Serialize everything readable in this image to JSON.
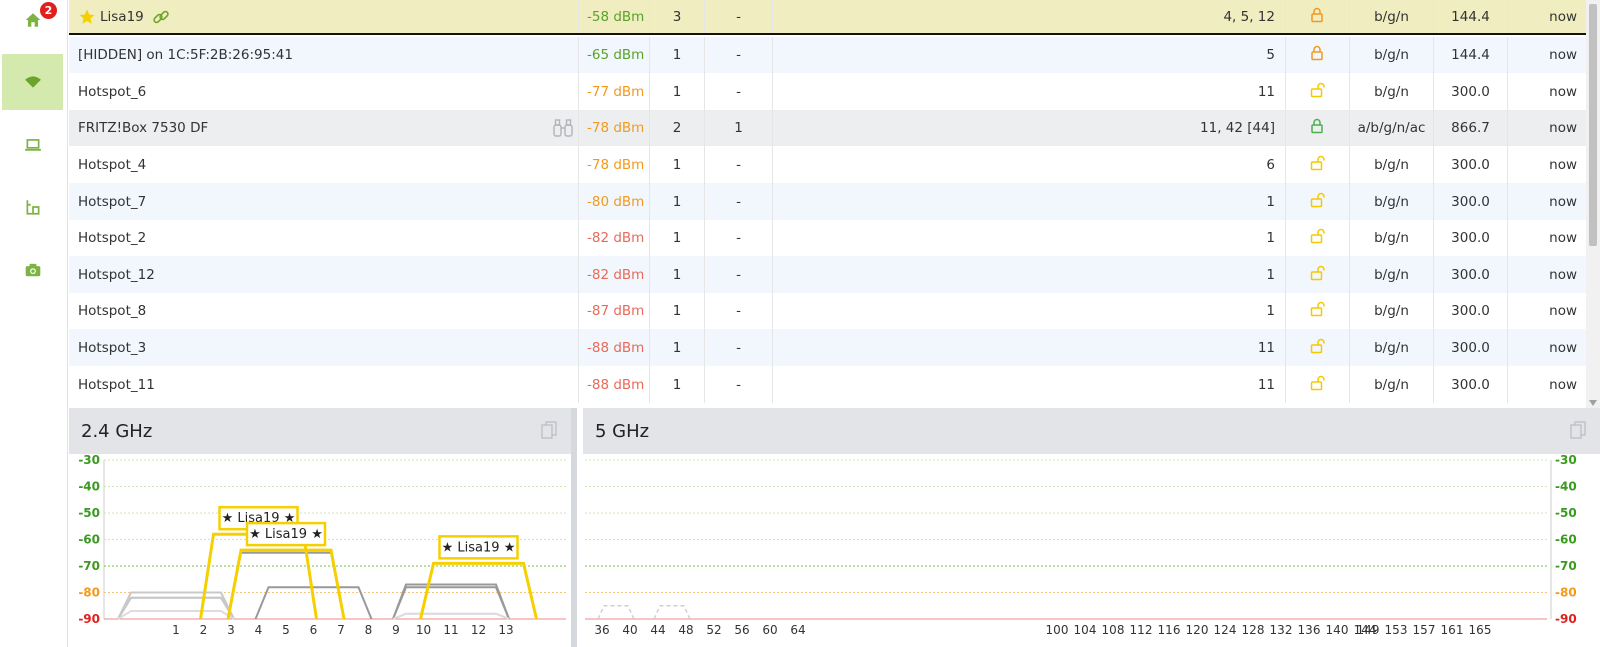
{
  "sidebar": {
    "badge": "2",
    "items": [
      {
        "icon": "home-icon"
      },
      {
        "icon": "wifi-icon",
        "active": true
      },
      {
        "icon": "laptop-icon"
      },
      {
        "icon": "floorplan-icon"
      },
      {
        "icon": "camera-icon"
      }
    ]
  },
  "networks": [
    {
      "ssid": "Lisa19",
      "signal": "-58 dBm",
      "signal_level": "green",
      "count": "3",
      "col4": "-",
      "channel": "4, 5, 12",
      "lock": "locked-orange",
      "mode": "b/g/n",
      "speed": "144.4",
      "seen": "now",
      "favorite": true,
      "connected": true
    },
    {
      "ssid": "[HIDDEN] on 1C:5F:2B:26:95:41",
      "signal": "-65 dBm",
      "signal_level": "green",
      "count": "1",
      "col4": "-",
      "channel": "5",
      "lock": "locked-orange",
      "mode": "b/g/n",
      "speed": "144.4",
      "seen": "now"
    },
    {
      "ssid": "Hotspot_6",
      "signal": "-77 dBm",
      "signal_level": "orange",
      "count": "1",
      "col4": "-",
      "channel": "11",
      "lock": "open-yellow",
      "mode": "b/g/n",
      "speed": "300.0",
      "seen": "now"
    },
    {
      "ssid": "FRITZ!Box 7530 DF",
      "signal": "-78 dBm",
      "signal_level": "orange",
      "count": "2",
      "col4": "1",
      "channel": "11, 42 [44]",
      "lock": "locked-green",
      "mode": "a/b/g/n/ac",
      "speed": "866.7",
      "seen": "now",
      "fritz": true
    },
    {
      "ssid": "Hotspot_4",
      "signal": "-78 dBm",
      "signal_level": "orange",
      "count": "1",
      "col4": "-",
      "channel": "6",
      "lock": "open-yellow",
      "mode": "b/g/n",
      "speed": "300.0",
      "seen": "now"
    },
    {
      "ssid": "Hotspot_7",
      "signal": "-80 dBm",
      "signal_level": "orange",
      "count": "1",
      "col4": "-",
      "channel": "1",
      "lock": "open-yellow",
      "mode": "b/g/n",
      "speed": "300.0",
      "seen": "now"
    },
    {
      "ssid": "Hotspot_2",
      "signal": "-82 dBm",
      "signal_level": "red",
      "count": "1",
      "col4": "-",
      "channel": "1",
      "lock": "open-yellow",
      "mode": "b/g/n",
      "speed": "300.0",
      "seen": "now"
    },
    {
      "ssid": "Hotspot_12",
      "signal": "-82 dBm",
      "signal_level": "red",
      "count": "1",
      "col4": "-",
      "channel": "1",
      "lock": "open-yellow",
      "mode": "b/g/n",
      "speed": "300.0",
      "seen": "now"
    },
    {
      "ssid": "Hotspot_8",
      "signal": "-87 dBm",
      "signal_level": "red",
      "count": "1",
      "col4": "-",
      "channel": "1",
      "lock": "open-yellow",
      "mode": "b/g/n",
      "speed": "300.0",
      "seen": "now"
    },
    {
      "ssid": "Hotspot_3",
      "signal": "-88 dBm",
      "signal_level": "red",
      "count": "1",
      "col4": "-",
      "channel": "11",
      "lock": "open-yellow",
      "mode": "b/g/n",
      "speed": "300.0",
      "seen": "now"
    },
    {
      "ssid": "Hotspot_11",
      "signal": "-88 dBm",
      "signal_level": "red",
      "count": "1",
      "col4": "-",
      "channel": "11",
      "lock": "open-yellow",
      "mode": "b/g/n",
      "speed": "300.0",
      "seen": "now"
    }
  ],
  "colors": {
    "green": "#5aa227",
    "orange": "#f39a1d",
    "red": "#e86a5a",
    "favorite": "#f5d000",
    "lock_orange": "#f39a1d",
    "lock_yellow": "#f5c800",
    "lock_green": "#4caf50",
    "accent": "#8bc34a"
  },
  "panels": {
    "band24_title": "2.4 GHz",
    "band5_title": "5 GHz"
  },
  "chart_data": [
    {
      "type": "area",
      "band": "2.4 GHz",
      "ylim": [
        -90,
        -30
      ],
      "yticks": [
        -30,
        -40,
        -50,
        -60,
        -70,
        -80,
        -90
      ],
      "xticks": [
        "1",
        "2",
        "3",
        "4",
        "5",
        "6",
        "7",
        "8",
        "9",
        "10",
        "11",
        "12",
        "13"
      ],
      "networks": [
        {
          "label": "★ Lisa19 ★",
          "center": 4,
          "signal": -58,
          "highlight": true
        },
        {
          "label": "★ Lisa19 ★",
          "center": 5,
          "signal": -64,
          "highlight": true
        },
        {
          "label": "★ Lisa19 ★",
          "center": 12,
          "signal": -69,
          "highlight": true
        },
        {
          "label": "",
          "center": 5,
          "signal": -65,
          "highlight": false
        },
        {
          "label": "",
          "center": 11,
          "signal": -77,
          "highlight": false
        },
        {
          "label": "",
          "center": 11,
          "signal": -78,
          "highlight": false
        },
        {
          "label": "",
          "center": 6,
          "signal": -78,
          "highlight": false
        },
        {
          "label": "",
          "center": 1,
          "signal": -80,
          "highlight": false
        },
        {
          "label": "",
          "center": 1,
          "signal": -82,
          "highlight": false
        },
        {
          "label": "",
          "center": 1,
          "signal": -82,
          "highlight": false
        },
        {
          "label": "",
          "center": 1,
          "signal": -87,
          "highlight": false
        },
        {
          "label": "",
          "center": 11,
          "signal": -88,
          "highlight": false
        },
        {
          "label": "",
          "center": 11,
          "signal": -88,
          "highlight": false
        }
      ]
    },
    {
      "type": "area",
      "band": "5 GHz",
      "ylim": [
        -90,
        -30
      ],
      "yticks": [
        -30,
        -40,
        -50,
        -60,
        -70,
        -80,
        -90
      ],
      "xticks": [
        "36",
        "40",
        "44",
        "48",
        "52",
        "56",
        "60",
        "64",
        "100",
        "104",
        "108",
        "112",
        "116",
        "120",
        "124",
        "128",
        "132",
        "136",
        "140",
        "144",
        "149",
        "153",
        "157",
        "161",
        "165"
      ],
      "networks": [
        {
          "label": "",
          "center": 38,
          "signal": -85,
          "dashed": true
        },
        {
          "label": "",
          "center": 46,
          "signal": -85,
          "dashed": true
        }
      ]
    }
  ]
}
